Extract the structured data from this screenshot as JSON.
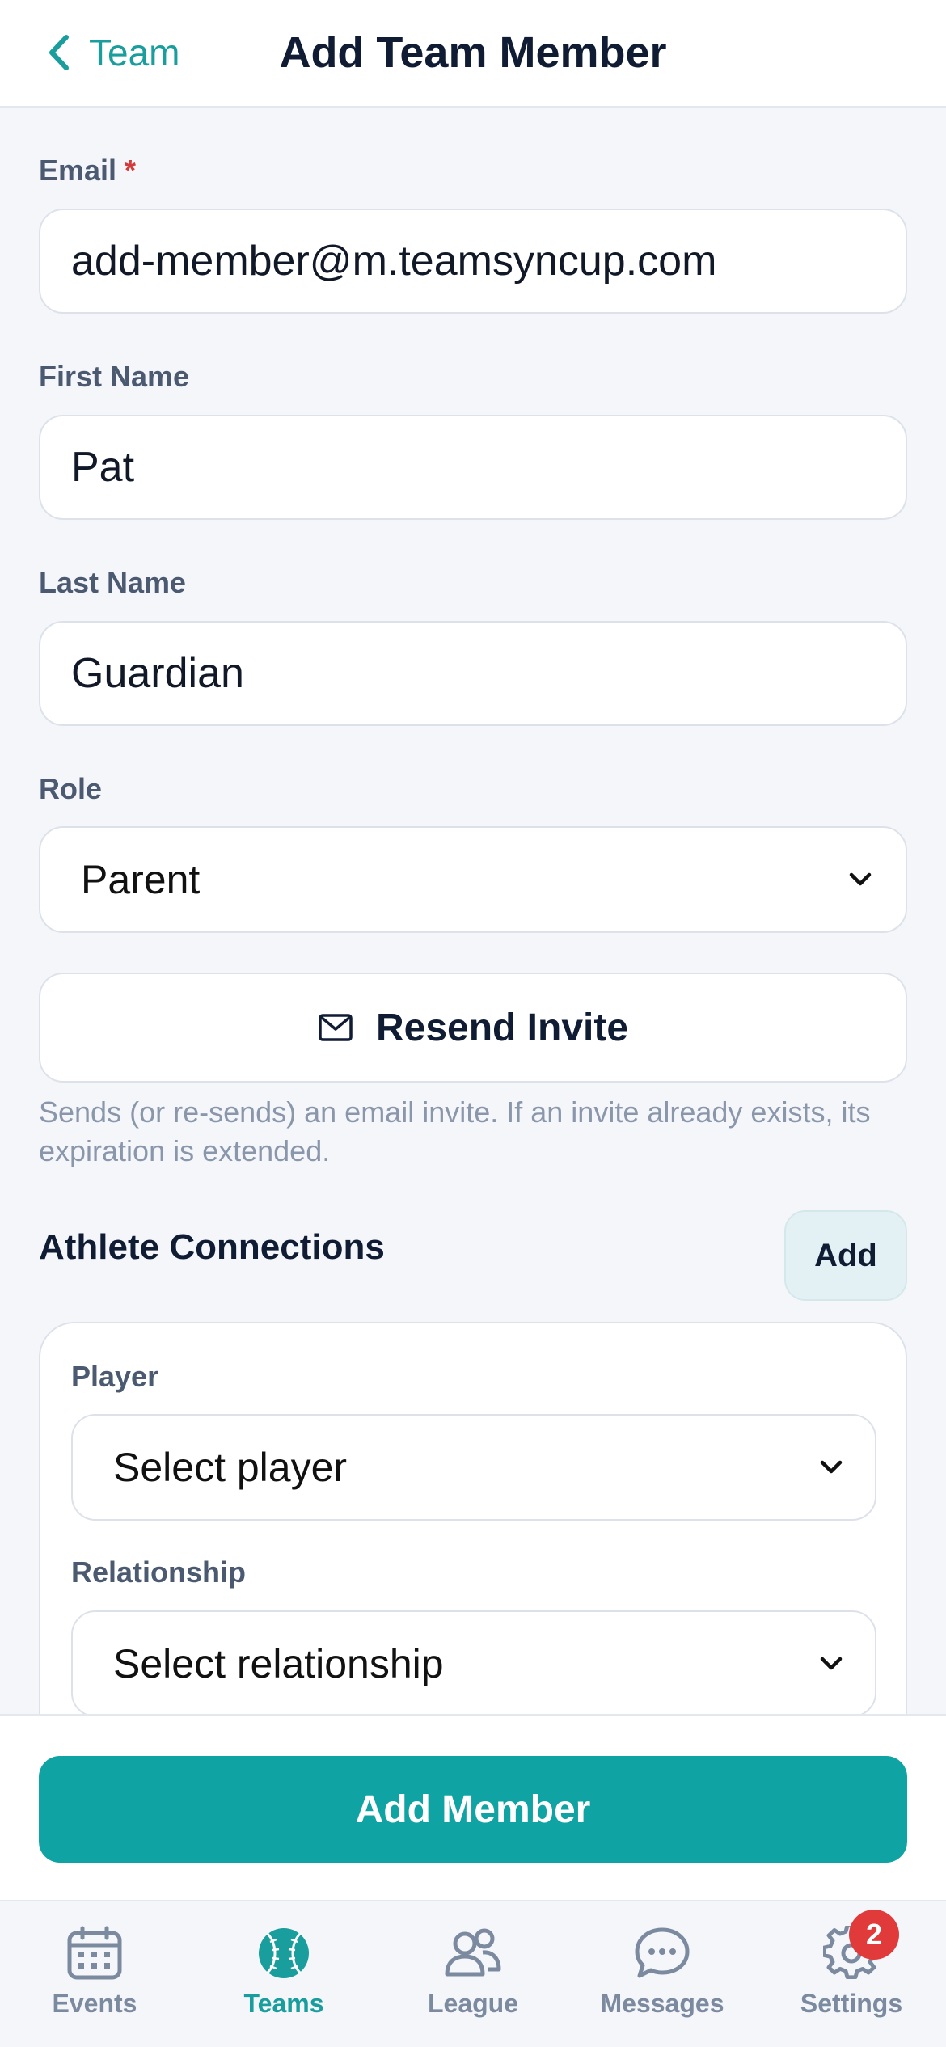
{
  "header": {
    "back_label": "Team",
    "title": "Add Team Member"
  },
  "form": {
    "email_label": "Email",
    "email_required": "*",
    "email_value": "add-member@m.teamsyncup.com",
    "first_name_label": "First Name",
    "first_name_value": "Pat",
    "last_name_label": "Last Name",
    "last_name_value": "Guardian",
    "role_label": "Role",
    "role_value": "Parent"
  },
  "invite": {
    "button_label": "Resend Invite",
    "help_text": "Sends (or re-sends) an email invite. If an invite already exists, its expiration is extended."
  },
  "connections": {
    "title": "Athlete Connections",
    "add_label": "Add",
    "player_label": "Player",
    "player_value": "Select player",
    "relationship_label": "Relationship",
    "relationship_value": "Select relationship"
  },
  "footer": {
    "primary_label": "Add Member"
  },
  "tabbar": {
    "tabs": [
      {
        "label": "Events",
        "icon": "calendar-icon"
      },
      {
        "label": "Teams",
        "icon": "baseball-icon"
      },
      {
        "label": "League",
        "icon": "people-icon"
      },
      {
        "label": "Messages",
        "icon": "chat-icon"
      },
      {
        "label": "Settings",
        "icon": "gear-icon"
      }
    ],
    "settings_badge": "2"
  },
  "colors": {
    "accent": "#1a9d9d",
    "primary_button": "#0fa3a3",
    "badge": "#e03a3a"
  }
}
